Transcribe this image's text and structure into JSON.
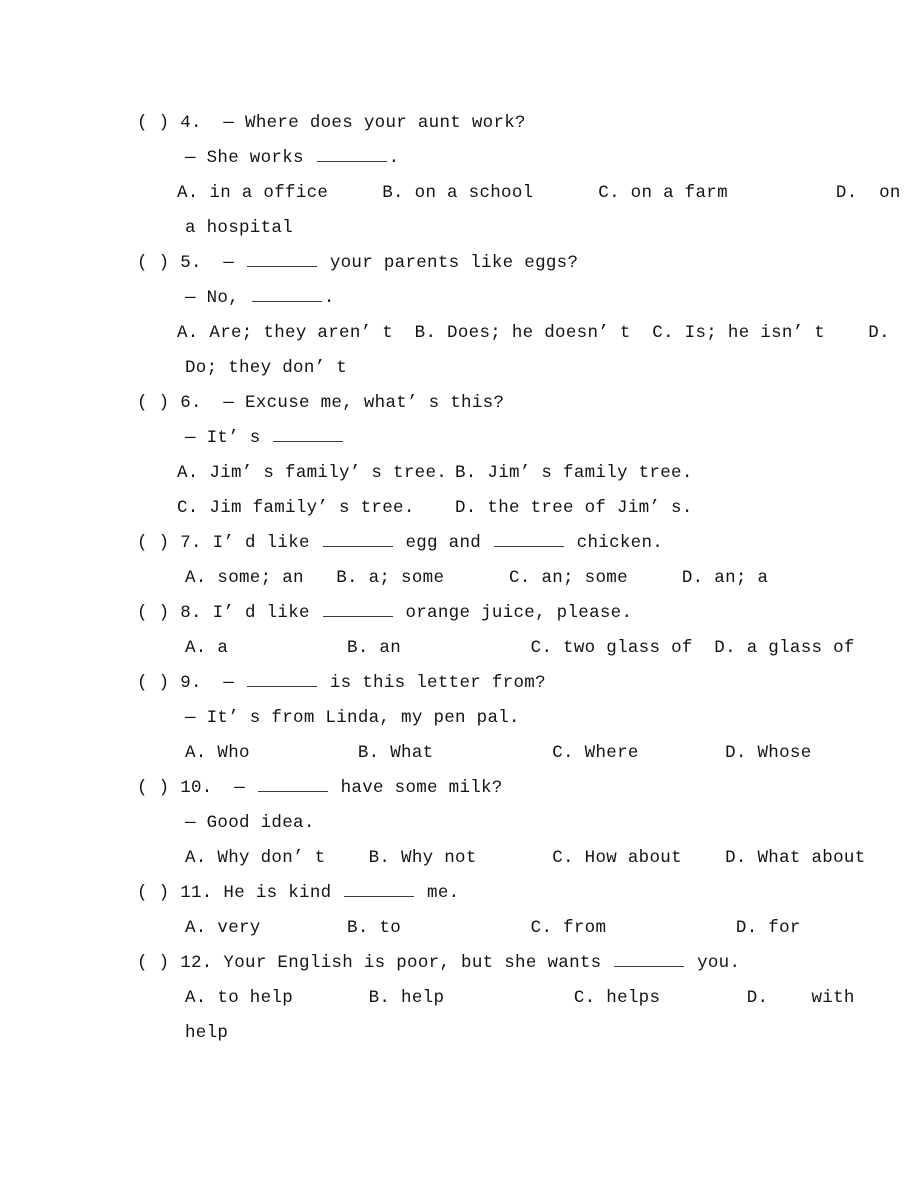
{
  "document": {
    "type": "english-grammar-worksheet",
    "ink_color": "#141414",
    "page_background": "#ffffff",
    "blank_symbol": "__________",
    "dash_symbol": "—",
    "checkbox_marker": "( )"
  },
  "questions": [
    {
      "number": "4.",
      "marker": "( )",
      "prompt": "— Where does your aunt work?",
      "continuation": "— She works __________.",
      "options_layout": "row-wrapped",
      "option_rows": [
        "A. in a office     B. on a school      C. on a farm          D.  on"
      ],
      "wrap_lines": [
        "a hospital"
      ],
      "options": [
        {
          "key": "A.",
          "text": "in a office"
        },
        {
          "key": "B.",
          "text": "on a school"
        },
        {
          "key": "C.",
          "text": "on a farm"
        },
        {
          "key": "D.",
          "text": "on a hospital"
        }
      ]
    },
    {
      "number": "5.",
      "marker": "( )",
      "prompt": "— __________ your parents like eggs?",
      "continuation": "— No, __________.",
      "options_layout": "row-wrapped",
      "option_rows": [
        "A. Are; they aren’ t  B. Does; he doesn’ t  C. Is; he isn’ t    D."
      ],
      "wrap_lines": [
        "Do; they don’ t"
      ],
      "options": [
        {
          "key": "A.",
          "text": "Are; they aren’ t"
        },
        {
          "key": "B.",
          "text": "Does; he doesn’ t"
        },
        {
          "key": "C.",
          "text": "Is; he isn’ t"
        },
        {
          "key": "D.",
          "text": "Do; they don’ t"
        }
      ]
    },
    {
      "number": "6.",
      "marker": "( )",
      "prompt": "— Excuse me, what’ s this?",
      "continuation": "— It’ s __________",
      "options_layout": "two-column",
      "option_rows": [
        "A. Jim’ s family’ s tree.              B. Jim’ s family tree.",
        "C. Jim family’ s tree.                 D. the tree of Jim’ s."
      ],
      "options": [
        {
          "key": "A.",
          "text": "Jim’ s family’ s tree."
        },
        {
          "key": "B.",
          "text": "Jim’ s family tree."
        },
        {
          "key": "C.",
          "text": "Jim family’ s tree."
        },
        {
          "key": "D.",
          "text": "the tree of Jim’ s."
        }
      ]
    },
    {
      "number": "7.",
      "marker": "( )",
      "prompt": "I’ d like __________ egg and __________ chicken.",
      "continuation": null,
      "options_layout": "single-row",
      "option_rows": [
        "A. some; an   B. a; some      C. an; some     D. an; a"
      ],
      "options": [
        {
          "key": "A.",
          "text": "some; an"
        },
        {
          "key": "B.",
          "text": "a; some"
        },
        {
          "key": "C.",
          "text": "an; some"
        },
        {
          "key": "D.",
          "text": "an; a"
        }
      ]
    },
    {
      "number": "8.",
      "marker": "( )",
      "prompt": "I’ d like __________ orange juice, please.",
      "continuation": null,
      "options_layout": "single-row",
      "option_rows": [
        "A. a           B. an            C. two glass of  D. a glass of"
      ],
      "options": [
        {
          "key": "A.",
          "text": "a"
        },
        {
          "key": "B.",
          "text": "an"
        },
        {
          "key": "C.",
          "text": "two glass of"
        },
        {
          "key": "D.",
          "text": "a glass of"
        }
      ]
    },
    {
      "number": "9.",
      "marker": "( )",
      "prompt": "— __________ is this letter from?",
      "continuation": "— It’ s from Linda, my pen pal.",
      "options_layout": "single-row",
      "option_rows": [
        "A. Who          B. What           C. Where        D. Whose"
      ],
      "options": [
        {
          "key": "A.",
          "text": "Who"
        },
        {
          "key": "B.",
          "text": "What"
        },
        {
          "key": "C.",
          "text": "Where"
        },
        {
          "key": "D.",
          "text": "Whose"
        }
      ]
    },
    {
      "number": "10.",
      "marker": "( )",
      "prompt": "— __________ have some milk?",
      "continuation": "— Good idea.",
      "options_layout": "single-row",
      "option_rows": [
        "A. Why don’ t    B. Why not       C. How about    D. What about"
      ],
      "options": [
        {
          "key": "A.",
          "text": "Why don’ t"
        },
        {
          "key": "B.",
          "text": "Why not"
        },
        {
          "key": "C.",
          "text": "How about"
        },
        {
          "key": "D.",
          "text": "What about"
        }
      ]
    },
    {
      "number": "11.",
      "marker": "( )",
      "prompt": "He is kind __________ me.",
      "continuation": null,
      "options_layout": "single-row",
      "option_rows": [
        "A. very        B. to            C. from            D. for"
      ],
      "options": [
        {
          "key": "A.",
          "text": "very"
        },
        {
          "key": "B.",
          "text": "to"
        },
        {
          "key": "C.",
          "text": "from"
        },
        {
          "key": "D.",
          "text": "for"
        }
      ]
    },
    {
      "number": "12.",
      "marker": "( )",
      "prompt": "Your English is poor, but she wants __________ you.",
      "continuation": null,
      "options_layout": "row-wrapped",
      "option_rows": [
        "A. to help       B. help            C. helps        D.    with"
      ],
      "wrap_lines": [
        "help"
      ],
      "options": [
        {
          "key": "A.",
          "text": "to help"
        },
        {
          "key": "B.",
          "text": "help"
        },
        {
          "key": "C.",
          "text": "helps"
        },
        {
          "key": "D.",
          "text": "with help"
        }
      ]
    }
  ],
  "lines": {
    "q4_prompt_a": "( ) 4.  — Where does your aunt work?",
    "q4_prompt_b": "— She works ",
    "q4_prompt_b_tail": ".",
    "q4_options": "A. in a office     B. on a school      C. on a farm          D.  on",
    "q4_wrap": "a hospital",
    "q5_prompt_a_head": "( ) 5.  — ",
    "q5_prompt_a_tail": " your parents like eggs?",
    "q5_prompt_b_head": "— No, ",
    "q5_prompt_b_tail": ".",
    "q5_options": "A. Are; they aren’ t  B. Does; he doesn’ t  C. Is; he isn’ t    D.",
    "q5_wrap": "Do; they don’ t",
    "q6_prompt_a": "( ) 6.  — Excuse me, what’ s this?",
    "q6_prompt_b_head": "— It’ s ",
    "q6_opt_a": "A. Jim’ s family’ s tree.",
    "q6_opt_b": "B. Jim’ s family tree.",
    "q6_opt_c": "C. Jim family’ s tree.",
    "q6_opt_d": "D. the tree of Jim’ s.",
    "q7_head": "( ) 7. I’ d like ",
    "q7_mid": " egg and ",
    "q7_tail": " chicken.",
    "q7_options": "A. some; an   B. a; some      C. an; some     D. an; a",
    "q8_head": "( ) 8. I’ d like ",
    "q8_tail": " orange juice, please.",
    "q8_options": "A. a           B. an            C. two glass of  D. a glass of",
    "q9_head": "( ) 9.  — ",
    "q9_tail": " is this letter from?",
    "q9_prompt_b": "— It’ s from Linda, my pen pal.",
    "q9_options": "A. Who          B. What           C. Where        D. Whose",
    "q10_head": "( ) 10.  — ",
    "q10_tail": " have some milk?",
    "q10_prompt_b": "— Good idea.",
    "q10_options": "A. Why don’ t    B. Why not       C. How about    D. What about",
    "q11_head": "( ) 11. He is kind ",
    "q11_tail": " me.",
    "q11_options": "A. very        B. to            C. from            D. for",
    "q12_head": "( ) 12. Your English is poor, but she wants ",
    "q12_tail": " you.",
    "q12_options": "A. to help       B. help            C. helps        D.    with",
    "q12_wrap": "help"
  }
}
